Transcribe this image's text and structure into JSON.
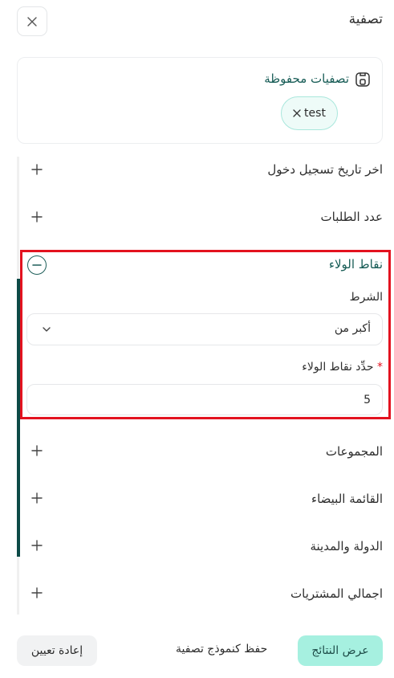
{
  "header": {
    "title": "تصفية"
  },
  "saved_filters": {
    "title": "تصفيات محفوظة",
    "chips": [
      {
        "label": "test"
      }
    ]
  },
  "sections": {
    "last_login": {
      "label": "اخر تاريخ تسجيل دخول"
    },
    "orders_count": {
      "label": "عدد الطلبات"
    },
    "loyalty_points": {
      "label": "نقاط الولاء",
      "condition_label": "الشرط",
      "condition_value": "أكبر من",
      "points_label": "حدِّد نقاط الولاء",
      "required_mark": "*",
      "points_value": "5"
    },
    "groups": {
      "label": "المجموعات"
    },
    "whitelist": {
      "label": "القائمة البيضاء"
    },
    "country_city": {
      "label": "الدولة والمدينة"
    },
    "total_purchases": {
      "label": "اجمالي المشتريات"
    }
  },
  "footer": {
    "show_results": "عرض النتائج",
    "save_as_model": "حفظ كنموذج تصفية",
    "reset": "إعادة تعيين"
  },
  "colors": {
    "accent_dark": "#0c4a47",
    "accent_light": "#a6f0e0",
    "highlight": "#e3121f"
  },
  "icons": {
    "close": "close-icon",
    "save": "save-icon",
    "chip_remove": "x-icon",
    "expand": "plus-icon",
    "collapse": "minus-icon",
    "dropdown": "chevron-down-icon"
  }
}
